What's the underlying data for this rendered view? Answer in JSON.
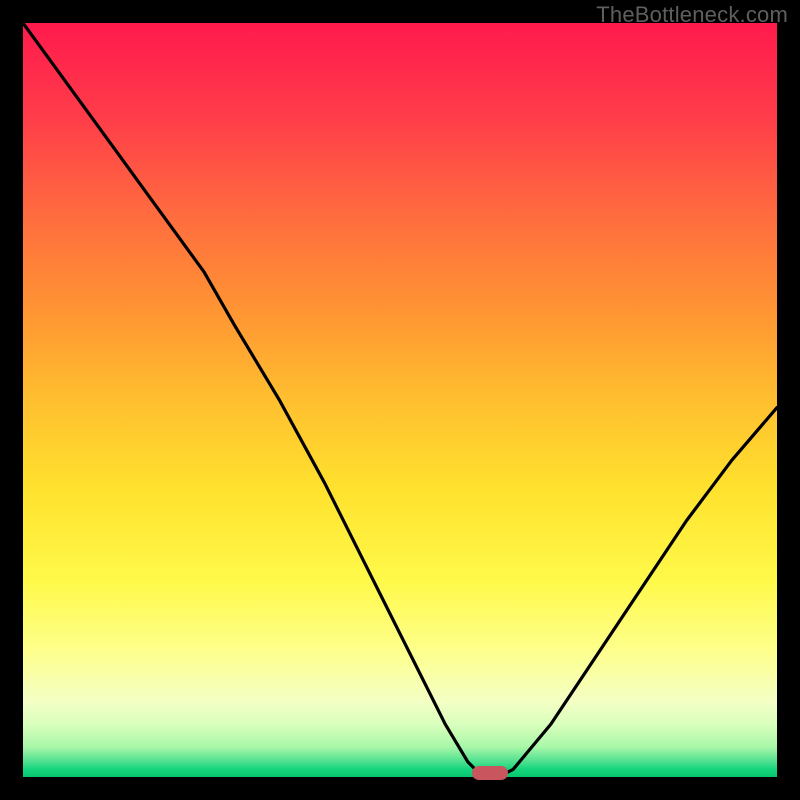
{
  "watermark": "TheBottleneck.com",
  "chart_data": {
    "type": "line",
    "title": "",
    "xlabel": "",
    "ylabel": "",
    "xlim": [
      0,
      100
    ],
    "ylim": [
      0,
      100
    ],
    "grid": false,
    "x": [
      0,
      8,
      16,
      24,
      28,
      34,
      40,
      46,
      52,
      56,
      59,
      60.5,
      62,
      64,
      65,
      70,
      76,
      82,
      88,
      94,
      100
    ],
    "values": [
      100,
      89,
      78,
      67,
      60,
      50,
      39,
      27,
      15,
      7,
      2,
      0.5,
      0.5,
      0.5,
      1,
      7,
      16,
      25,
      34,
      42,
      49
    ],
    "marker": {
      "x": 62,
      "y": 0.5
    },
    "colors": {
      "line": "#000000",
      "marker": "#c9565f",
      "gradient_top": "#ff1a4d",
      "gradient_bottom": "#07c46f"
    }
  }
}
